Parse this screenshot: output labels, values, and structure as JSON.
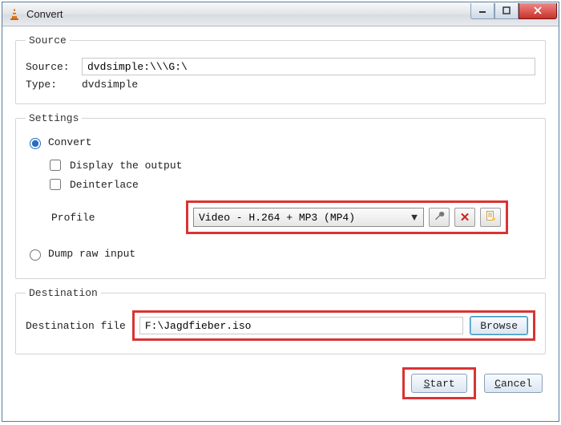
{
  "window": {
    "title": "Convert",
    "app_icon": "vlc-cone-icon"
  },
  "source": {
    "legend": "Source",
    "source_label": "Source:",
    "source_value": "dvdsimple:\\\\\\G:\\",
    "type_label": "Type:",
    "type_value": "dvdsimple"
  },
  "settings": {
    "legend": "Settings",
    "convert_label": "Convert",
    "convert_checked": true,
    "display_output_label": "Display the output",
    "display_output_checked": false,
    "deinterlace_label": "Deinterlace",
    "deinterlace_checked": false,
    "profile_label": "Profile",
    "profile_selected": "Video - H.264 + MP3 (MP4)",
    "dump_label": "Dump raw input",
    "dump_checked": false
  },
  "destination": {
    "legend": "Destination",
    "file_label": "Destination file",
    "file_value": "F:\\Jagdfieber.iso",
    "browse_label": "Browse"
  },
  "buttons": {
    "start": "Start",
    "cancel": "Cancel"
  }
}
